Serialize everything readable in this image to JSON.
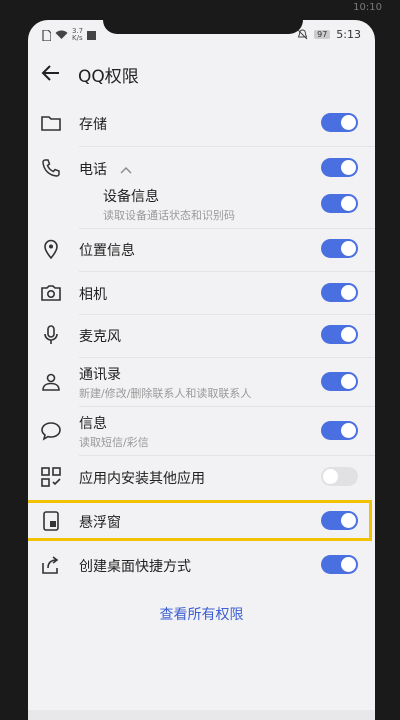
{
  "device": {
    "top_time_fragment": "10:10"
  },
  "status_bar": {
    "net_speed_value": "3.7",
    "net_speed_unit": "K/s",
    "battery": "97",
    "time": "5:13"
  },
  "header": {
    "title": "QQ权限"
  },
  "permissions": [
    {
      "title": "存储",
      "icon": "folder-icon",
      "enabled": true
    },
    {
      "title": "电话",
      "icon": "phone-icon",
      "enabled": true,
      "expanded": true
    },
    {
      "title": "设备信息",
      "subtitle": "读取设备通话状态和识别码",
      "enabled": true
    },
    {
      "title": "位置信息",
      "icon": "location-icon",
      "enabled": true
    },
    {
      "title": "相机",
      "icon": "camera-icon",
      "enabled": true
    },
    {
      "title": "麦克风",
      "icon": "microphone-icon",
      "enabled": true
    },
    {
      "title": "通讯录",
      "subtitle": "新建/修改/删除联系人和读取联系人",
      "icon": "contacts-icon",
      "enabled": true
    },
    {
      "title": "信息",
      "subtitle": "读取短信/彩信",
      "icon": "message-icon",
      "enabled": true
    },
    {
      "title": "应用内安装其他应用",
      "icon": "apps-icon",
      "enabled": false
    },
    {
      "title": "悬浮窗",
      "icon": "floating-window-icon",
      "enabled": true
    },
    {
      "title": "创建桌面快捷方式",
      "icon": "shortcut-icon",
      "enabled": true
    }
  ],
  "footer": {
    "see_all_label": "查看所有权限"
  },
  "colors": {
    "accent": "#4a6fe0",
    "highlight": "#f2c200",
    "link": "#3c5fd1"
  }
}
